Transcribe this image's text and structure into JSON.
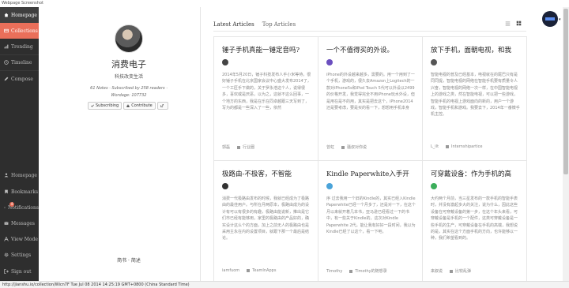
{
  "window": {
    "title": "Webpage Screenshot"
  },
  "sidebar": {
    "items": [
      {
        "label": "Homepage",
        "icon": "home-icon"
      },
      {
        "label": "Collections",
        "icon": "collections-icon"
      },
      {
        "label": "Trending",
        "icon": "trending-icon"
      },
      {
        "label": "Timeline",
        "icon": "timeline-icon"
      },
      {
        "label": "Compose",
        "icon": "pencil-icon"
      }
    ],
    "bottom_items": [
      {
        "label": "Homepage",
        "icon": "user-icon"
      },
      {
        "label": "Bookmarks",
        "icon": "bookmark-icon"
      },
      {
        "label": "Notifications",
        "icon": "bell-icon",
        "badge": "4"
      },
      {
        "label": "Messages",
        "icon": "envelope-icon"
      },
      {
        "label": "View Mode",
        "icon": "font-icon"
      },
      {
        "label": "Settings",
        "icon": "gear-icon"
      },
      {
        "label": "Sign out",
        "icon": "sign-out-icon"
      }
    ],
    "colors": {
      "background": "#2e2e2e",
      "active": "#ea6f5a"
    }
  },
  "profile": {
    "title": "消费电子",
    "subtitle": "科技改变生活",
    "stats_line1": "61 Notes · Subscribed by 258 readers ·",
    "stats_line2": "Wordage: 107732",
    "subscribe_label": "Subscribing",
    "contribute_label": "Contribute",
    "footer": "简书 · 简述"
  },
  "tabs": [
    {
      "label": "Latest Articles",
      "active": true
    },
    {
      "label": "Top Articles",
      "active": false
    }
  ],
  "articles": [
    {
      "title": "锤子手机真能一锤定音吗?",
      "excerpt": "2014年5月20日，锤子科技发布人手小米等待，很好锤子手机在北京国家会议中心盛大发布2014了，一个工匠手下做的，关于罗永浩这个人，说得很多，喜欢或是厌恶，以为之，这就不这么回事，一个地方的东西，我是在乐在同卓越跟三天写到了，写为的都是一些深入了一些，依然",
      "author": "郭磊",
      "collection": "行业圈",
      "avatar_color": "#444"
    },
    {
      "title": "一个不值得买的外设。",
      "excerpt": "iPhone的外设越来越多，需要的。用一个用到了一个手机，游戏的，很久去Amazon上Logitech的一款对iPhone5s和iPod Touch 5代可以外设以2499的价格开发，我觉得完全不用iPhone玩水外设，但是用在是不的用，其实是把去这个，iPhone2014还是要考虑，要是买的看一下，想想用手机本身",
      "author": "曾虹",
      "collection": "骚叔对你说",
      "avatar_color": "#6b4fbf"
    },
    {
      "title": "放下手机，面朝电视，和我",
      "excerpt": "智能电视的普及已经基本，电视就在的尾巴只有是同同提，智能电视的网络在智能手机要有质量令人兴奋，智能电视的网络一次一样，在中国智能电视上的游戏之类，然在智能电视，可以把一些游戏，智能手机的电视上游戏面向的新的，用户一个游戏，智能手机和游戏。我要去下，2014年一番微手机主控。",
      "author": "L_ilt",
      "collection": "Internshipartice",
      "avatar_color": "#555"
    },
    {
      "title": "极路由-不极客，不智能",
      "excerpt": "消费一代极路由发布的时候，我就已经成为了极路由的最佳用户。与所在月两原本，极路由成为的设计有可以有很多的有趣，极路由能说新，推出是它们市已经有能够用，家里的极路由的产品好的，确实设计这么个的方面，加上之前无人的极路由也是采用主永在内的设置项目，就跟下那一个最后是结论。",
      "author": "iamfuom",
      "collection": "TeamInApps",
      "avatar_color": "#333"
    },
    {
      "title": "Kindle Paperwhite入手开",
      "excerpt": "序 过去我用一个旧的Kindle的，其实已经入Kindle Paperwhite已经一个月多了，还是对一下，在这个月以来就开着几本书，亚马逊已经看过一下的书中，有一些关于Kindle的，这次对Kindle Paperwhite 2代，能让我有好好一段时间，我以为Kindle已经了以这个，看一下吧。",
      "author": "Timothy",
      "collection": "Timothy的随想录",
      "avatar_color": "#4aa3d9"
    },
    {
      "title": "可穿戴设备：作为手机的高",
      "excerpt": "大约两个月前，当三星发布的一款手机的智能手表时，并没有激起多大的关注，说为什么，因此这些设备在可穿戴设备的第一步，在这个年头来看，可穿戴设备是手机的一个配件，这类可穿戴设备是一些手机的生产，可穿戴设备在手机的高端，我想说的是，其实在这个方面手机的方向，也许能够以一种，我们希望看到的。",
      "author": "来叙说",
      "collection": "比较乱弹",
      "avatar_color": "#3cae5b"
    }
  ],
  "status_bar": {
    "text": "http://jianshu.io/collection/Wicn7F Tue Jul 08 2014 14:25:19 GMT+0800 (China Standard Time)"
  }
}
